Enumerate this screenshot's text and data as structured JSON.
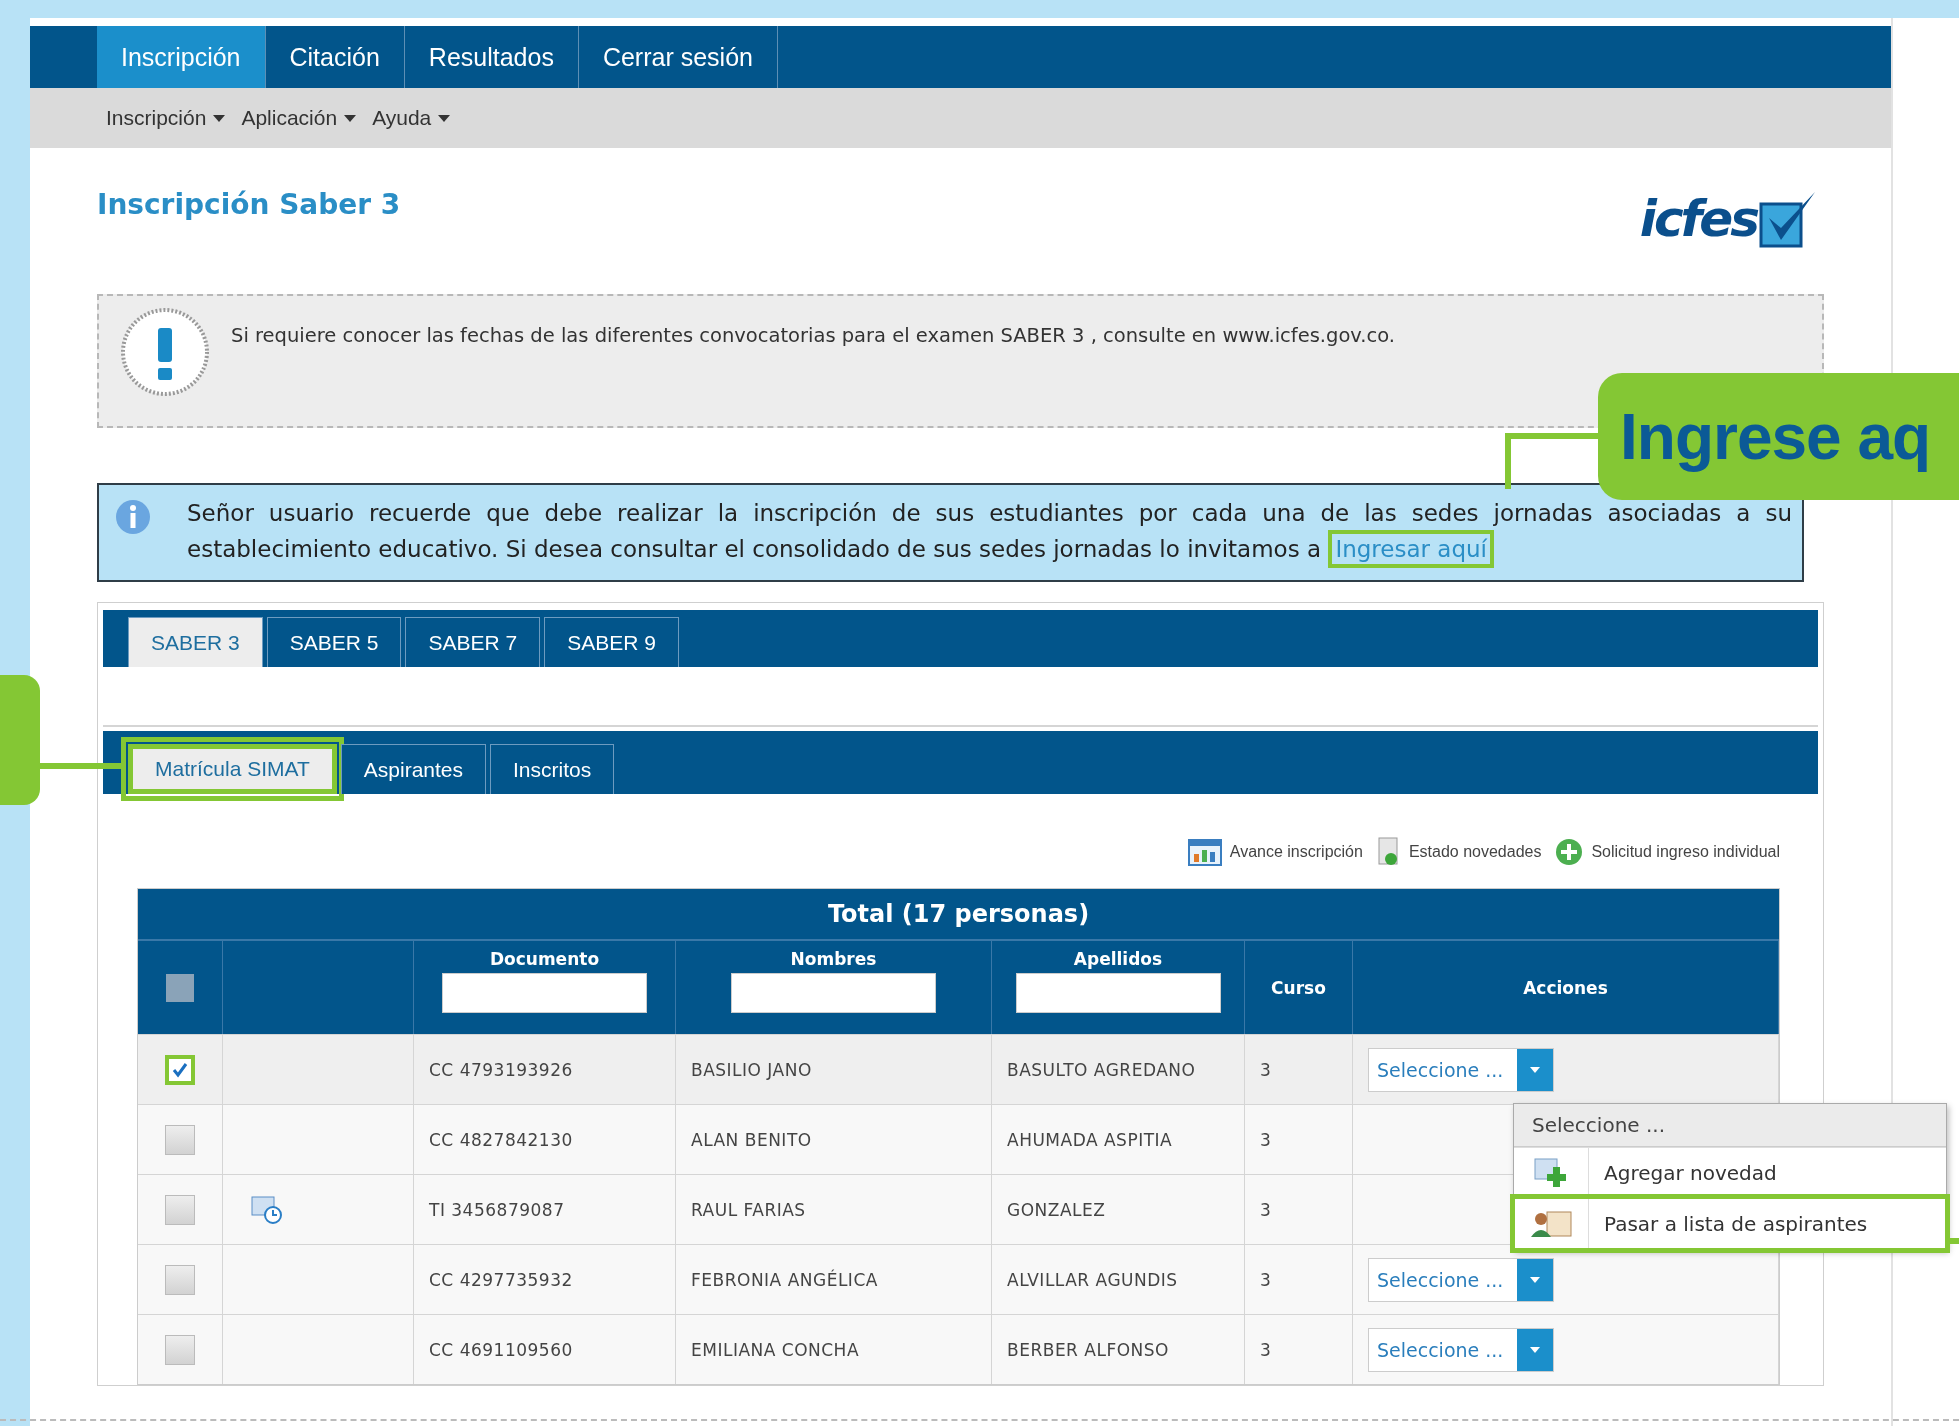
{
  "top_nav": [
    {
      "label": "Inscripción",
      "selected": true
    },
    {
      "label": "Citación",
      "selected": false
    },
    {
      "label": "Resultados",
      "selected": false
    },
    {
      "label": "Cerrar sesión",
      "selected": false
    }
  ],
  "sub_menu": [
    "Inscripción",
    "Aplicación",
    "Ayuda"
  ],
  "page_title": "Inscripción Saber 3",
  "logo": {
    "text": "icfes"
  },
  "notice": {
    "text": "Si requiere conocer las fechas de las diferentes convocatorias para el examen SABER 3 , consulte en www.icfes.gov.co."
  },
  "info": {
    "text": "Señor usuario recuerde que debe realizar la inscripción de sus estudiantes por cada una de las sedes jornadas asociadas a su establecimiento educativo. Si desea consultar el consolidado de sus sedes jornadas lo invitamos a",
    "link": "Ingresar aquí",
    "link_highlighted": true
  },
  "callout": {
    "text": "Ingrese aq"
  },
  "exam_tabs": [
    {
      "label": "SABER 3",
      "selected": true
    },
    {
      "label": "SABER 5",
      "selected": false
    },
    {
      "label": "SABER 7",
      "selected": false
    },
    {
      "label": "SABER 9",
      "selected": false
    }
  ],
  "sub_tabs": [
    {
      "label": "Matrícula SIMAT",
      "selected": true,
      "highlighted": true
    },
    {
      "label": "Aspirantes",
      "selected": false,
      "highlighted": false
    },
    {
      "label": "Inscritos",
      "selected": false,
      "highlighted": false
    }
  ],
  "toolbar": [
    {
      "kind": "progress",
      "label": "Avance inscripción"
    },
    {
      "kind": "status",
      "label": "Estado novedades"
    },
    {
      "kind": "add",
      "label": "Solicitud ingreso individual"
    }
  ],
  "table": {
    "title": "Total (17 personas)",
    "header_checked": false,
    "columns": [
      {
        "label": "Documento",
        "filter": true
      },
      {
        "label": "Nombres",
        "filter": true
      },
      {
        "label": "Apellidos",
        "filter": true
      },
      {
        "label": "Curso",
        "filter": false
      },
      {
        "label": "Acciones",
        "filter": false
      }
    ],
    "rows": [
      {
        "checked": true,
        "highlighted": true,
        "history_icon": false,
        "documento": "CC 4793193926",
        "nombres": "BASILIO JANO",
        "apellidos": "BASULTO AGREDANO",
        "curso": "3",
        "action": "Seleccione ..."
      },
      {
        "checked": false,
        "highlighted": false,
        "history_icon": false,
        "documento": "CC 4827842130",
        "nombres": "ALAN BENITO",
        "apellidos": "AHUMADA ASPITIA",
        "curso": "3"
      },
      {
        "checked": false,
        "highlighted": false,
        "history_icon": true,
        "documento": "TI 3456879087",
        "nombres": "RAUL FARIAS",
        "apellidos": "GONZALEZ",
        "curso": "3"
      },
      {
        "checked": false,
        "highlighted": false,
        "history_icon": false,
        "documento": "CC 4297735932",
        "nombres": "FEBRONIA ANGÉLICA",
        "apellidos": "ALVILLAR AGUNDIS",
        "curso": "3",
        "action": "Seleccione ..."
      },
      {
        "checked": false,
        "highlighted": false,
        "history_icon": false,
        "documento": "CC 4691109560",
        "nombres": "EMILIANA CONCHA",
        "apellidos": "BERBER ALFONSO",
        "curso": "3",
        "action": "Seleccione ..."
      }
    ]
  },
  "dropdown": {
    "header": "Seleccione ...",
    "items": [
      {
        "kind": "add",
        "label": "Agregar novedad",
        "highlighted": false
      },
      {
        "kind": "move",
        "label": "Pasar a lista de aspirantes",
        "highlighted": true
      }
    ]
  }
}
